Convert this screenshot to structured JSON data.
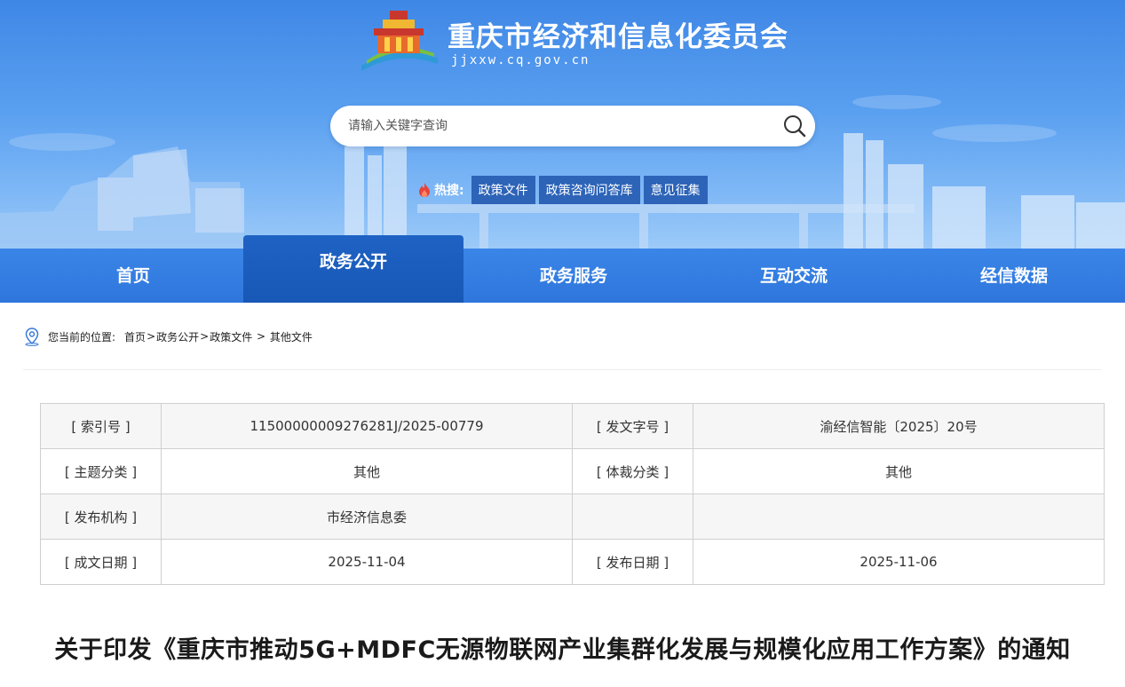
{
  "header": {
    "site_title": "重庆市经济和信息化委员会",
    "site_domain": "jjxxw.cq.gov.cn",
    "search_placeholder": "请输入关键字查询",
    "hot_label": "热搜:",
    "hot_tags": [
      "政策文件",
      "政策咨询问答库",
      "意见征集"
    ]
  },
  "nav": {
    "items": [
      "首页",
      "政务公开",
      "政务服务",
      "互动交流",
      "经信数据"
    ],
    "active": "政务公开"
  },
  "breadcrumb": {
    "prefix": "您当前的位置:",
    "items": [
      "首页",
      "政务公开",
      "政策文件",
      "其他文件"
    ],
    "separators": [
      ">",
      ">",
      " > "
    ]
  },
  "info": {
    "rows": [
      {
        "label1": "[ 索引号 ]",
        "value1": "11500000009276281J/2025-00779",
        "label2": "[ 发文字号 ]",
        "value2": "渝经信智能〔2025〕20号"
      },
      {
        "label1": "[ 主题分类 ]",
        "value1": "其他",
        "label2": "[ 体裁分类 ]",
        "value2": "其他"
      },
      {
        "label1": "[ 发布机构 ]",
        "value1": "市经济信息委",
        "label2": "",
        "value2": ""
      },
      {
        "label1": "[ 成文日期 ]",
        "value1": "2025-11-04",
        "label2": "[ 发布日期 ]",
        "value2": "2025-11-06"
      }
    ]
  },
  "article": {
    "title": "关于印发《重庆市推动5G+MDFC无源物联网产业集群化发展与规模化应用工作方案》的通知"
  },
  "colors": {
    "header_blue": "#3f87e6",
    "nav_blue": "#2f76dc",
    "nav_active": "#1858b6",
    "hot_tag_bg": "#2d64b8"
  }
}
